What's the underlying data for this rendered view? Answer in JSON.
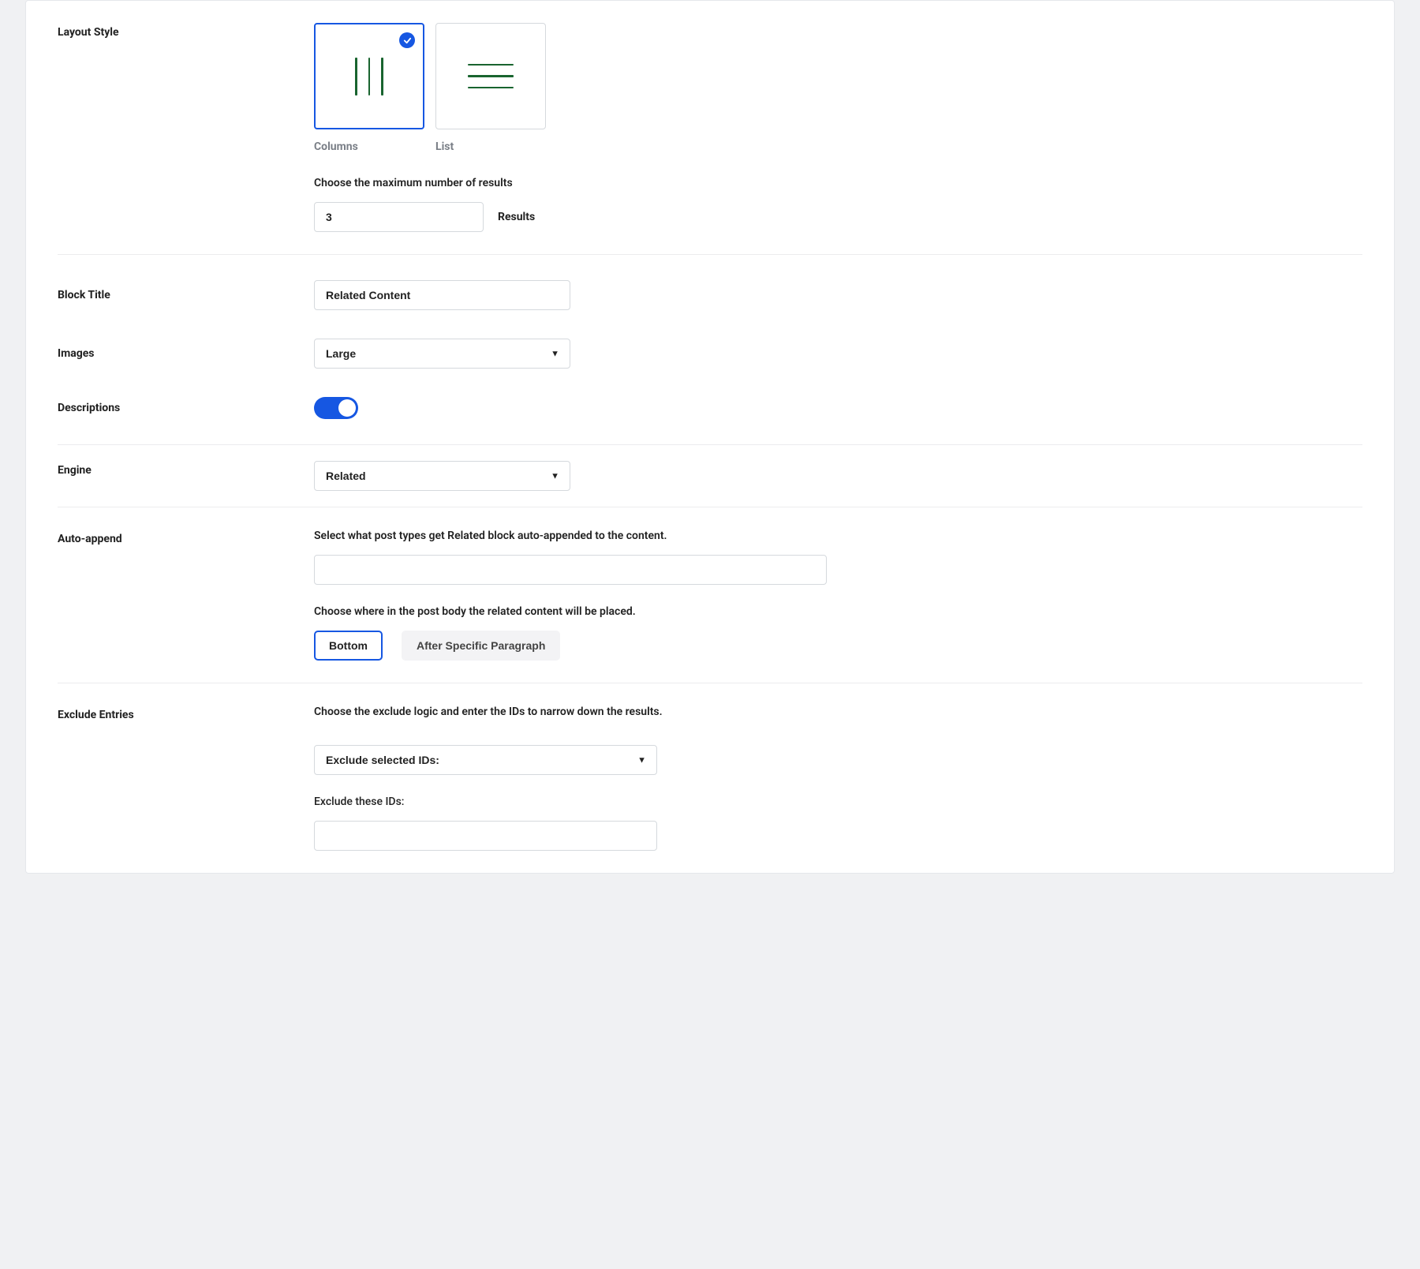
{
  "layout_style": {
    "label": "Layout Style",
    "card_columns": "Columns",
    "card_list": "List",
    "results_help": "Choose the maximum number of results",
    "results_value": "3",
    "results_suffix": "Results"
  },
  "block_title": {
    "label": "Block Title",
    "value": "Related Content"
  },
  "images": {
    "label": "Images",
    "value": "Large"
  },
  "descriptions": {
    "label": "Descriptions"
  },
  "engine": {
    "label": "Engine",
    "value": "Related"
  },
  "auto_append": {
    "label": "Auto-append",
    "help1": "Select what post types get Related block auto-appended to the content.",
    "help2": "Choose where in the post body the related content will be placed.",
    "tab_bottom": "Bottom",
    "tab_after": "After Specific Paragraph"
  },
  "exclude": {
    "label": "Exclude Entries",
    "help": "Choose the exclude logic and enter the IDs to narrow down the results.",
    "logic_value": "Exclude selected IDs:",
    "ids_label": "Exclude these IDs:"
  }
}
